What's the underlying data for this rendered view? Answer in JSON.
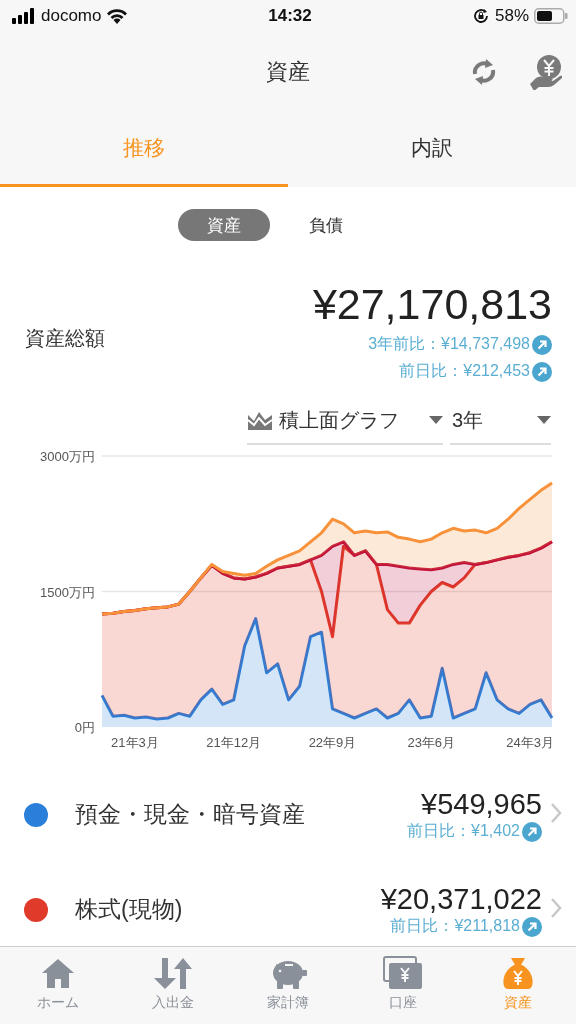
{
  "status_bar": {
    "carrier": "docomo",
    "time": "14:32",
    "battery": "58%"
  },
  "nav": {
    "title": "資産"
  },
  "tabs": [
    {
      "label": "推移",
      "selected": true
    },
    {
      "label": "内訳",
      "selected": false
    }
  ],
  "segments": [
    {
      "label": "資産",
      "selected": true
    },
    {
      "label": "負債",
      "selected": false
    }
  ],
  "summary": {
    "label": "資産総額",
    "amount": "¥27,170,813",
    "changes": [
      "3年前比：¥14,737,498",
      "前日比：¥212,453"
    ]
  },
  "dropdowns": [
    {
      "label": "積上面グラフ"
    },
    {
      "label": "3年"
    }
  ],
  "chart_data": {
    "type": "area",
    "stacked": true,
    "categories": [
      null,
      null,
      null,
      "21年3月",
      null,
      null,
      null,
      null,
      null,
      null,
      null,
      null,
      "21年12月",
      null,
      null,
      null,
      null,
      null,
      null,
      null,
      null,
      "22年9月",
      null,
      null,
      null,
      null,
      null,
      null,
      null,
      null,
      "23年6月",
      null,
      null,
      null,
      null,
      null,
      null,
      null,
      null,
      "24年3月",
      null,
      null
    ],
    "ylim": [
      0,
      3000
    ],
    "yticks": [
      {
        "value": 0,
        "label": "0円"
      },
      {
        "value": 1500,
        "label": "1500万円"
      },
      {
        "value": 3000,
        "label": "3000万円"
      }
    ],
    "series": [
      {
        "color": "#2a7fdb",
        "values": [
          350,
          120,
          130,
          100,
          110,
          90,
          100,
          150,
          120,
          300,
          420,
          250,
          300,
          900,
          1200,
          600,
          700,
          300,
          450,
          1000,
          1050,
          200,
          150,
          100,
          150,
          200,
          100,
          150,
          300,
          100,
          120,
          650,
          100,
          150,
          200,
          600,
          300,
          200,
          150,
          250,
          300,
          100
        ]
      },
      {
        "color": "#e03a2a",
        "values": [
          900,
          1140,
          1150,
          1190,
          1200,
          1230,
          1230,
          1210,
          1380,
          1350,
          1370,
          1450,
          1350,
          740,
          460,
          1100,
          1060,
          1480,
          1350,
          850,
          450,
          800,
          1850,
          1800,
          1800,
          1600,
          1200,
          1000,
          850,
          1250,
          1380,
          950,
          1450,
          1500,
          1600,
          1220,
          1550,
          1680,
          1750,
          1680,
          1680,
          1950
        ]
      },
      {
        "color": "#c0103c",
        "values": [
          0,
          0,
          0,
          0,
          0,
          0,
          0,
          0,
          0,
          0,
          0,
          0,
          0,
          0,
          0,
          0,
          0,
          0,
          0,
          0,
          400,
          1000,
          50,
          0,
          0,
          0,
          500,
          630,
          610,
          400,
          240,
          160,
          250,
          170,
          0,
          0,
          0,
          0,
          0,
          0,
          0,
          0
        ]
      },
      {
        "color": "#f7923a",
        "values": [
          0,
          0,
          0,
          0,
          0,
          0,
          0,
          0,
          0,
          0,
          10,
          20,
          50,
          40,
          40,
          80,
          90,
          120,
          150,
          200,
          250,
          300,
          200,
          250,
          220,
          350,
          360,
          320,
          320,
          300,
          340,
          390,
          400,
          350,
          380,
          330,
          350,
          420,
          520,
          590,
          640,
          650
        ]
      }
    ]
  },
  "categories": [
    {
      "name": "預金・現金・暗号資産",
      "amount": "¥549,965",
      "change": "前日比：¥1,402",
      "color": "#2a7fdb"
    },
    {
      "name": "株式(現物)",
      "amount": "¥20,371,022",
      "change": "前日比：¥211,818",
      "color": "#e03a2a"
    }
  ],
  "tab_bar": [
    {
      "label": "ホーム",
      "selected": false
    },
    {
      "label": "入出金",
      "selected": false
    },
    {
      "label": "家計簿",
      "selected": false
    },
    {
      "label": "口座",
      "selected": false
    },
    {
      "label": "資産",
      "selected": true
    }
  ]
}
